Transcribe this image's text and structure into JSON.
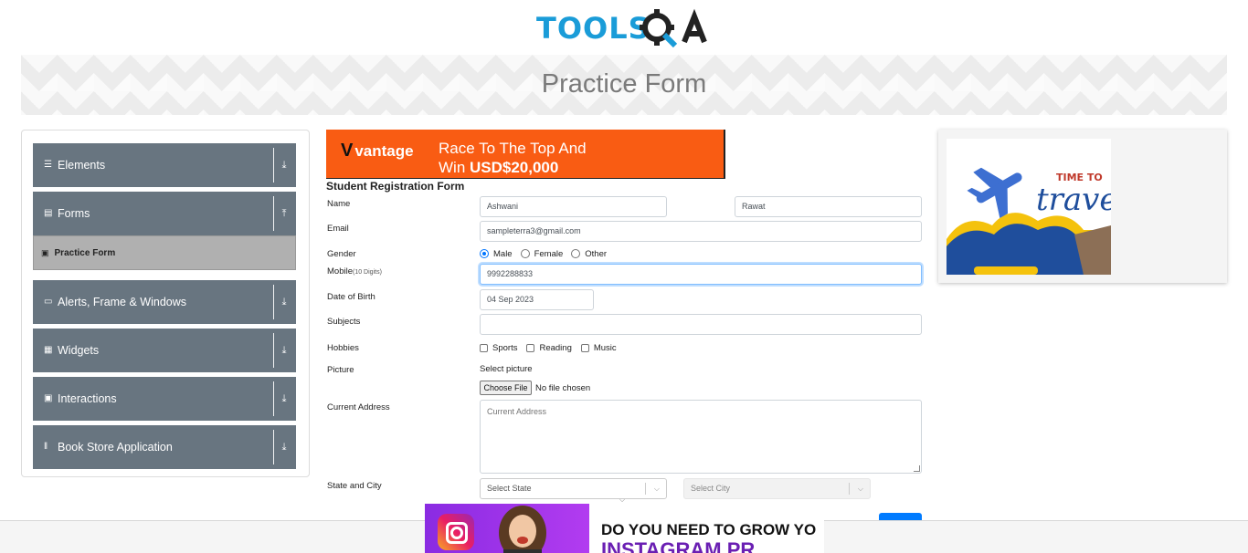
{
  "header": {
    "logo_text": "TOOLS",
    "logo_suffix": "QA",
    "page_title": "Practice Form"
  },
  "sidebar": {
    "groups": [
      {
        "label": "Elements",
        "icon": "hamburger-icon",
        "arrow": "download-arrow-icon"
      },
      {
        "label": "Forms",
        "icon": "form-icon",
        "arrow": "upload-arrow-icon"
      },
      {
        "label": "Alerts, Frame & Windows",
        "icon": "window-icon",
        "arrow": "download-arrow-icon"
      },
      {
        "label": "Widgets",
        "icon": "grid-icon",
        "arrow": "download-arrow-icon"
      },
      {
        "label": "Interactions",
        "icon": "interaction-icon",
        "arrow": "download-arrow-icon"
      },
      {
        "label": "Book Store Application",
        "icon": "books-icon",
        "arrow": "download-arrow-icon"
      }
    ],
    "active_item": {
      "label": "Practice Form",
      "icon": "html-icon"
    }
  },
  "ad_top": {
    "brand": "vantage",
    "line1": "Race To The Top And",
    "line2_prefix": "Win ",
    "line2_bold": "USD$20,000"
  },
  "form": {
    "title": "Student Registration Form",
    "labels": {
      "name": "Name",
      "email": "Email",
      "gender": "Gender",
      "mobile": "Mobile",
      "mobile_hint": "(10 Digits)",
      "dob": "Date of Birth",
      "subjects": "Subjects",
      "hobbies": "Hobbies",
      "picture": "Picture",
      "address": "Current Address",
      "state_city": "State and City"
    },
    "first_name": "Ashwani",
    "last_name": "Rawat",
    "email": "sampleterra3@gmail.com",
    "gender_options": [
      "Male",
      "Female",
      "Other"
    ],
    "gender_selected": "Male",
    "mobile": "9992288833",
    "dob": "04 Sep 2023",
    "subjects": "",
    "hobbies": [
      "Sports",
      "Reading",
      "Music"
    ],
    "picture_label": "Select picture",
    "file_button": "Choose File",
    "file_status": "No file chosen",
    "address_placeholder": "Current Address",
    "state_placeholder": "Select State",
    "city_placeholder": "Select City"
  },
  "ad_right": {
    "text_small": "TIME TO",
    "text_script": "trave"
  },
  "ad_bottom": {
    "line1": "DO YOU NEED TO GROW YO",
    "line2": "INSTAGRAM PR"
  },
  "colors": {
    "accent": "#1a9cd8",
    "sidebar_group": "#687580",
    "sidebar_active": "#b0b0b0",
    "ad_orange": "#f95c13",
    "primary": "#007bff"
  }
}
